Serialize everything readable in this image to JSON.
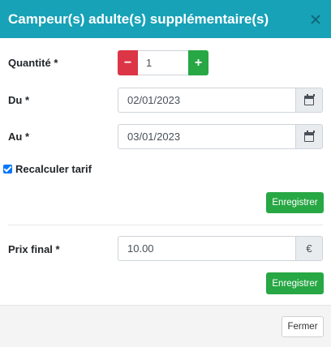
{
  "modal": {
    "title": "Campeur(s) adulte(s) supplémentaire(s)",
    "close_icon": "close-icon"
  },
  "form": {
    "quantity": {
      "label": "Quantité *",
      "value": "1",
      "minus": "−",
      "plus": "+"
    },
    "start_date": {
      "label": "Du *",
      "value": "02/01/2023",
      "icon": "calendar-icon"
    },
    "end_date": {
      "label": "Au *",
      "value": "03/01/2023",
      "icon": "calendar-icon"
    },
    "recalculate": {
      "label": "Recalculer tarif",
      "checked": true
    },
    "save_label": "Enregistrer"
  },
  "price": {
    "label": "Prix final *",
    "value": "10.00",
    "currency": "€",
    "save_label": "Enregistrer"
  },
  "footer": {
    "close_label": "Fermer"
  },
  "colors": {
    "header": "#17a2b8",
    "danger": "#dc3545",
    "success": "#28a745",
    "checkbox": "#0075ff"
  }
}
